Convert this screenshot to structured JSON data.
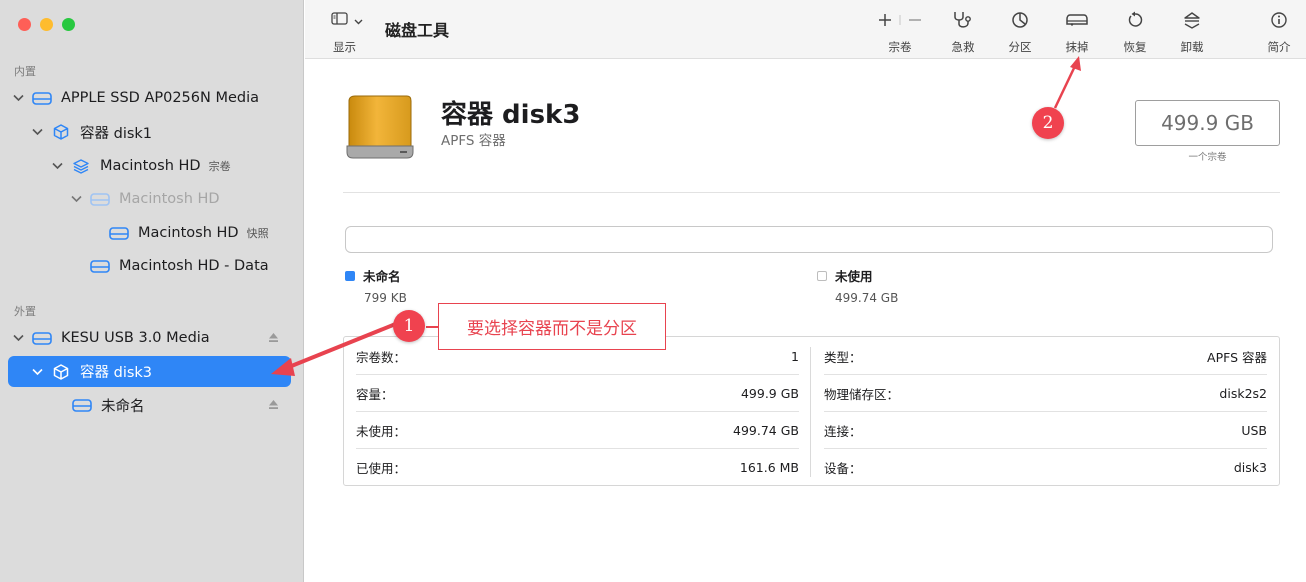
{
  "window": {
    "app_title": "磁盘工具",
    "view_label": "显示"
  },
  "toolbar": {
    "volume": {
      "label": "宗卷",
      "icon": "plus-minus-icon"
    },
    "firstaid": {
      "label": "急救",
      "icon": "stethoscope-icon"
    },
    "partition": {
      "label": "分区",
      "icon": "pie-chart-icon"
    },
    "erase": {
      "label": "抹掉",
      "icon": "eraser-icon"
    },
    "restore": {
      "label": "恢复",
      "icon": "restore-icon"
    },
    "unmount": {
      "label": "卸载",
      "icon": "unmount-icon"
    },
    "info": {
      "label": "简介",
      "icon": "info-icon"
    }
  },
  "sidebar": {
    "internal_label": "内置",
    "external_label": "外置",
    "items": [
      {
        "label": "APPLE SSD AP0256N Media",
        "sub": ""
      },
      {
        "label": "容器 disk1",
        "sub": ""
      },
      {
        "label": "Macintosh HD",
        "sub": "宗卷"
      },
      {
        "label": "Macintosh HD",
        "sub": ""
      },
      {
        "label": "Macintosh HD",
        "sub": "快照"
      },
      {
        "label": "Macintosh HD - Data",
        "sub": ""
      },
      {
        "label": "KESU USB 3.0 Media",
        "sub": ""
      },
      {
        "label": "容器 disk3",
        "sub": ""
      },
      {
        "label": "未命名",
        "sub": ""
      }
    ]
  },
  "detail": {
    "name": "容器 disk3",
    "type": "APFS 容器",
    "capacity": "499.9 GB",
    "capacity_note": "一个宗卷",
    "legend": [
      {
        "label": "未命名",
        "value": "799 KB",
        "color": "#2f86f6"
      },
      {
        "label": "未使用",
        "value": "499.74 GB",
        "color": "#ffffff"
      }
    ],
    "info_left": [
      {
        "key": "宗卷数：",
        "value": "1"
      },
      {
        "key": "容量：",
        "value": "499.9 GB"
      },
      {
        "key": "未使用：",
        "value": "499.74 GB"
      },
      {
        "key": "已使用：",
        "value": "161.6 MB"
      }
    ],
    "info_right": [
      {
        "key": "类型：",
        "value": "APFS 容器"
      },
      {
        "key": "物理储存区：",
        "value": "disk2s2"
      },
      {
        "key": "连接：",
        "value": "USB"
      },
      {
        "key": "设备：",
        "value": "disk3"
      }
    ]
  },
  "annotations": {
    "badge1": "1",
    "badge2": "2",
    "callout_text": "要选择容器而不是分区",
    "color": "#e8434f"
  }
}
